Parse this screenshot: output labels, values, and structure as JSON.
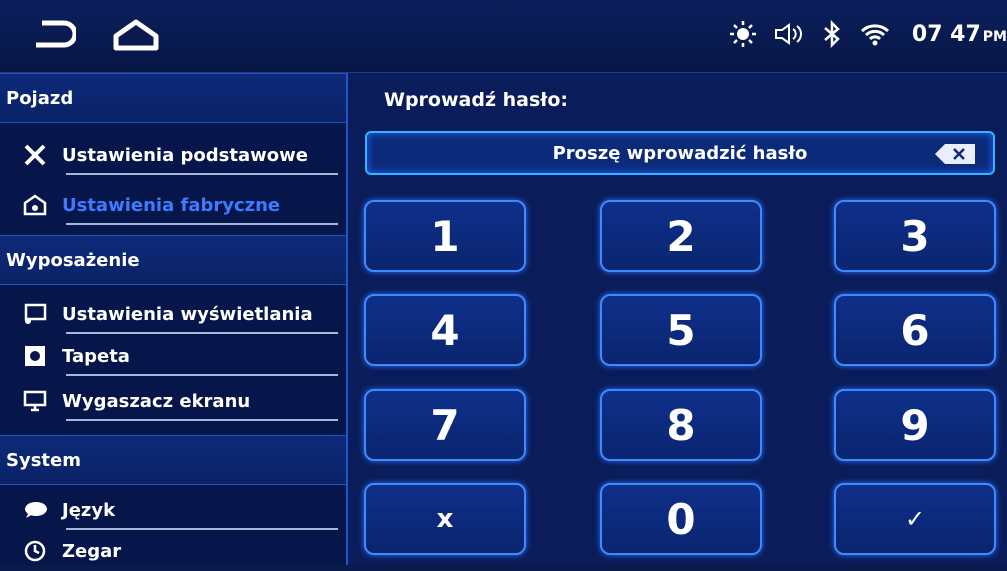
{
  "status": {
    "time": "07 47",
    "ampm": "PM"
  },
  "sidebar": {
    "categories": [
      "Pojazd",
      "Wyposażenie",
      "System"
    ],
    "items": [
      {
        "label": "Ustawienia podstawowe"
      },
      {
        "label": "Ustawienia fabryczne"
      },
      {
        "label": "Ustawienia wyświetlania"
      },
      {
        "label": "Tapeta"
      },
      {
        "label": "Wygaszacz ekranu"
      },
      {
        "label": "Język"
      },
      {
        "label": "Zegar"
      }
    ]
  },
  "main": {
    "prompt": "Wprowadź hasło:",
    "placeholder": "Proszę wprowadzić hasło",
    "keys": [
      "1",
      "2",
      "3",
      "4",
      "5",
      "6",
      "7",
      "8",
      "9",
      "x",
      "0",
      "✓"
    ]
  },
  "colors": {
    "accent": "#3d7bff",
    "border": "#3d8cff"
  }
}
